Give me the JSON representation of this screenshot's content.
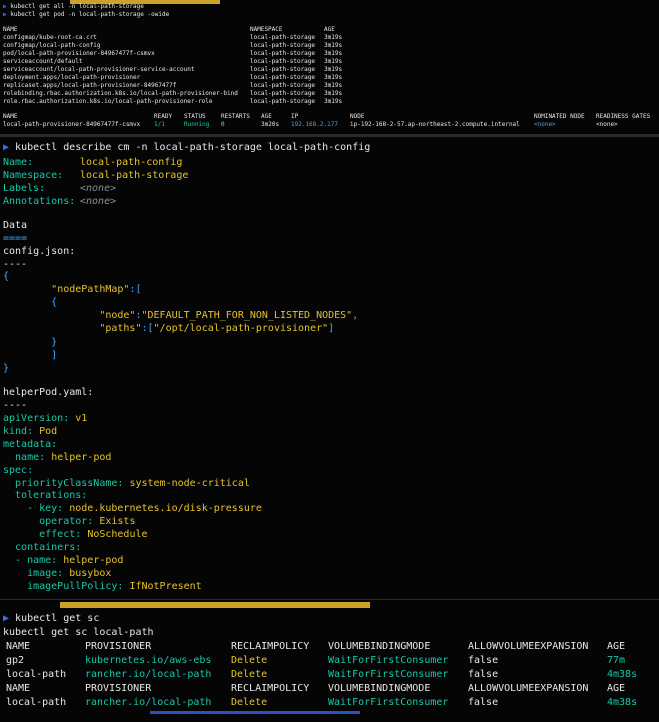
{
  "pane1": {
    "commands": [
      "kubectl get all -n local-path-storage",
      "kubectl get pod -n local-path-storage -owide"
    ],
    "all_headers": [
      "NAME",
      "NAMESPACE",
      "AGE"
    ],
    "all_rows": [
      [
        "configmap/kube-root-ca.crt",
        "local-path-storage",
        "3m19s"
      ],
      [
        "configmap/local-path-config",
        "local-path-storage",
        "3m19s"
      ],
      [
        "pod/local-path-provisioner-84967477f-csmvx",
        "local-path-storage",
        "3m19s"
      ],
      [
        "serviceaccount/default",
        "local-path-storage",
        "3m19s"
      ],
      [
        "serviceaccount/local-path-provisioner-service-account",
        "local-path-storage",
        "3m19s"
      ],
      [
        "deployment.apps/local-path-provisioner",
        "local-path-storage",
        "3m19s"
      ],
      [
        "replicaset.apps/local-path-provisioner-84967477f",
        "local-path-storage",
        "3m19s"
      ],
      [
        "rolebinding.rbac.authorization.k8s.io/local-path-provisioner-bind",
        "local-path-storage",
        "3m19s"
      ],
      [
        "role.rbac.authorization.k8s.io/local-path-provisioner-role",
        "local-path-storage",
        "3m19s"
      ]
    ],
    "pod_headers": [
      "NAME",
      "READY",
      "STATUS",
      "RESTARTS",
      "AGE",
      "IP",
      "NODE",
      "NOMINATED NODE",
      "READINESS GATES"
    ],
    "pod_row": [
      "local-path-provisioner-84967477f-csmvx",
      "1/1",
      "Running",
      "0",
      "3m20s",
      "192.168.2.177",
      "ip-192-168-2-57.ap-northeast-2.compute.internal",
      "<none>",
      "<none>"
    ]
  },
  "pane2": {
    "command": "kubectl describe cm -n local-path-storage local-path-config",
    "meta": [
      {
        "key": "Name:",
        "value": "local-path-config"
      },
      {
        "key": "Namespace:",
        "value": "local-path-storage"
      },
      {
        "key": "Labels:",
        "value": "<none>"
      },
      {
        "key": "Annotations:",
        "value": "<none>"
      }
    ],
    "data_title": "Data",
    "data_rule": "====",
    "config_key": "config.json:",
    "dash_rule": "----",
    "json_lines": [
      "{",
      "        \"nodePathMap\":[",
      "        {",
      "                \"node\":\"DEFAULT_PATH_FOR_NON_LISTED_NODES\",",
      "                \"paths\":[\"/opt/local-path-provisioner\"]",
      "        }",
      "        ]",
      "}"
    ],
    "helper_key": "helperPod.yaml:",
    "yaml": {
      "api_key": "apiVersion:",
      "api_val": "v1",
      "kind_key": "kind:",
      "kind_val": "Pod",
      "metadata_key": "metadata:",
      "name_key": "  name:",
      "name_val": "helper-pod",
      "spec_key": "spec:",
      "pcn_key": "  priorityClassName:",
      "pcn_val": "system-node-critical",
      "tol_key": "  tolerations:",
      "key_key": "    - key:",
      "key_val": "node.kubernetes.io/disk-pressure",
      "op_key": "      operator:",
      "op_val": "Exists",
      "eff_key": "      effect:",
      "eff_val": "NoSchedule",
      "cont_key": "  containers:",
      "cname_key": "  - name:",
      "cname_val": "helper-pod",
      "img_key": "    image:",
      "img_val": "busybox",
      "ipp_key": "    imagePullPolicy:",
      "ipp_val": "IfNotPresent"
    }
  },
  "pane3": {
    "commands": [
      "kubectl get sc",
      "kubectl get sc local-path"
    ],
    "headers": [
      "NAME",
      "PROVISIONER",
      "RECLAIMPOLICY",
      "VOLUMEBINDINGMODE",
      "ALLOWVOLUMEEXPANSION",
      "AGE"
    ],
    "rows1": [
      [
        "gp2",
        "kubernetes.io/aws-ebs",
        "Delete",
        "WaitForFirstConsumer",
        "false",
        "77m"
      ],
      [
        "local-path",
        "rancher.io/local-path",
        "Delete",
        "WaitForFirstConsumer",
        "false",
        "4m38s"
      ]
    ],
    "rows2": [
      [
        "local-path",
        "rancher.io/local-path",
        "Delete",
        "WaitForFirstConsumer",
        "false",
        "4m38s"
      ]
    ]
  },
  "colors": {
    "prompt": "#3a6cf2",
    "green": "#18c8a8",
    "yellow": "#e6c32a",
    "cyan": "#3fa9ff",
    "background": "#050505"
  }
}
